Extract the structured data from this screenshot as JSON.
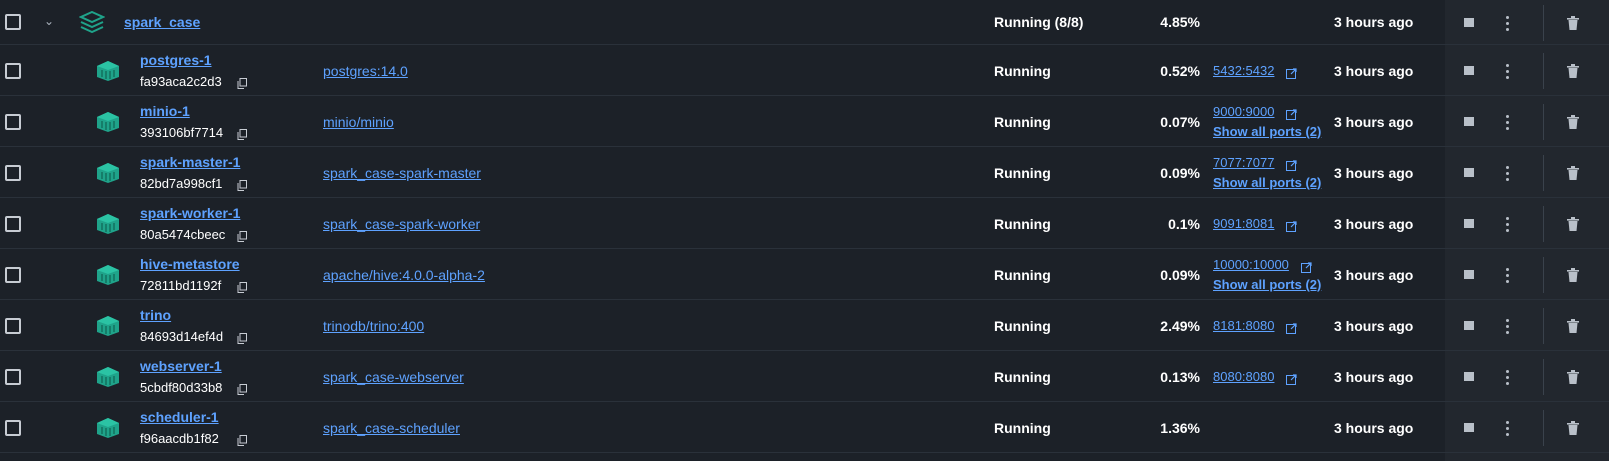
{
  "group": {
    "name": "spark_case",
    "status": "Running (8/8)",
    "cpu": "4.85%",
    "started": "3 hours ago",
    "icon": "stack-layers-icon",
    "expanded": true
  },
  "containers": [
    {
      "name": "postgres-1",
      "id": "fa93aca2c2d3",
      "image": "postgres:14.0",
      "status": "Running",
      "cpu": "0.52%",
      "port": "5432:5432",
      "show_all_ports": "",
      "started": "3 hours ago"
    },
    {
      "name": "minio-1",
      "id": "393106bf7714",
      "image": "minio/minio",
      "status": "Running",
      "cpu": "0.07%",
      "port": "9000:9000",
      "show_all_ports": "Show all ports (2)",
      "started": "3 hours ago"
    },
    {
      "name": "spark-master-1",
      "id": "82bd7a998cf1",
      "image": "spark_case-spark-master",
      "status": "Running",
      "cpu": "0.09%",
      "port": "7077:7077",
      "show_all_ports": "Show all ports (2)",
      "started": "3 hours ago"
    },
    {
      "name": "spark-worker-1",
      "id": "80a5474cbeec",
      "image": "spark_case-spark-worker",
      "status": "Running",
      "cpu": "0.1%",
      "port": "9091:8081",
      "show_all_ports": "",
      "started": "3 hours ago"
    },
    {
      "name": "hive-metastore",
      "id": "72811bd1192f",
      "image": "apache/hive:4.0.0-alpha-2",
      "status": "Running",
      "cpu": "0.09%",
      "port": "10000:10000",
      "show_all_ports": "Show all ports (2)",
      "started": "3 hours ago"
    },
    {
      "name": "trino",
      "id": "84693d14ef4d",
      "image": "trinodb/trino:400",
      "status": "Running",
      "cpu": "2.49%",
      "port": "8181:8080",
      "show_all_ports": "",
      "started": "3 hours ago"
    },
    {
      "name": "webserver-1",
      "id": "5cbdf80d33b8",
      "image": "spark_case-webserver",
      "status": "Running",
      "cpu": "0.13%",
      "port": "8080:8080",
      "show_all_ports": "",
      "started": "3 hours ago"
    },
    {
      "name": "scheduler-1",
      "id": "f96aacdb1f82",
      "image": "spark_case-scheduler",
      "status": "Running",
      "cpu": "1.36%",
      "port": "",
      "show_all_ports": "",
      "started": "3 hours ago"
    }
  ],
  "icons": {
    "container": "container-icon",
    "copy": "copy-icon",
    "external": "external-link-icon",
    "stop": "stop-icon",
    "more": "more-vertical-icon",
    "delete": "trash-icon",
    "chevron": "chevron-down-icon"
  },
  "colors": {
    "background": "#1c2128",
    "link": "#5ea2ff",
    "container_icon": "#1fa38a",
    "text": "#ffffff"
  }
}
